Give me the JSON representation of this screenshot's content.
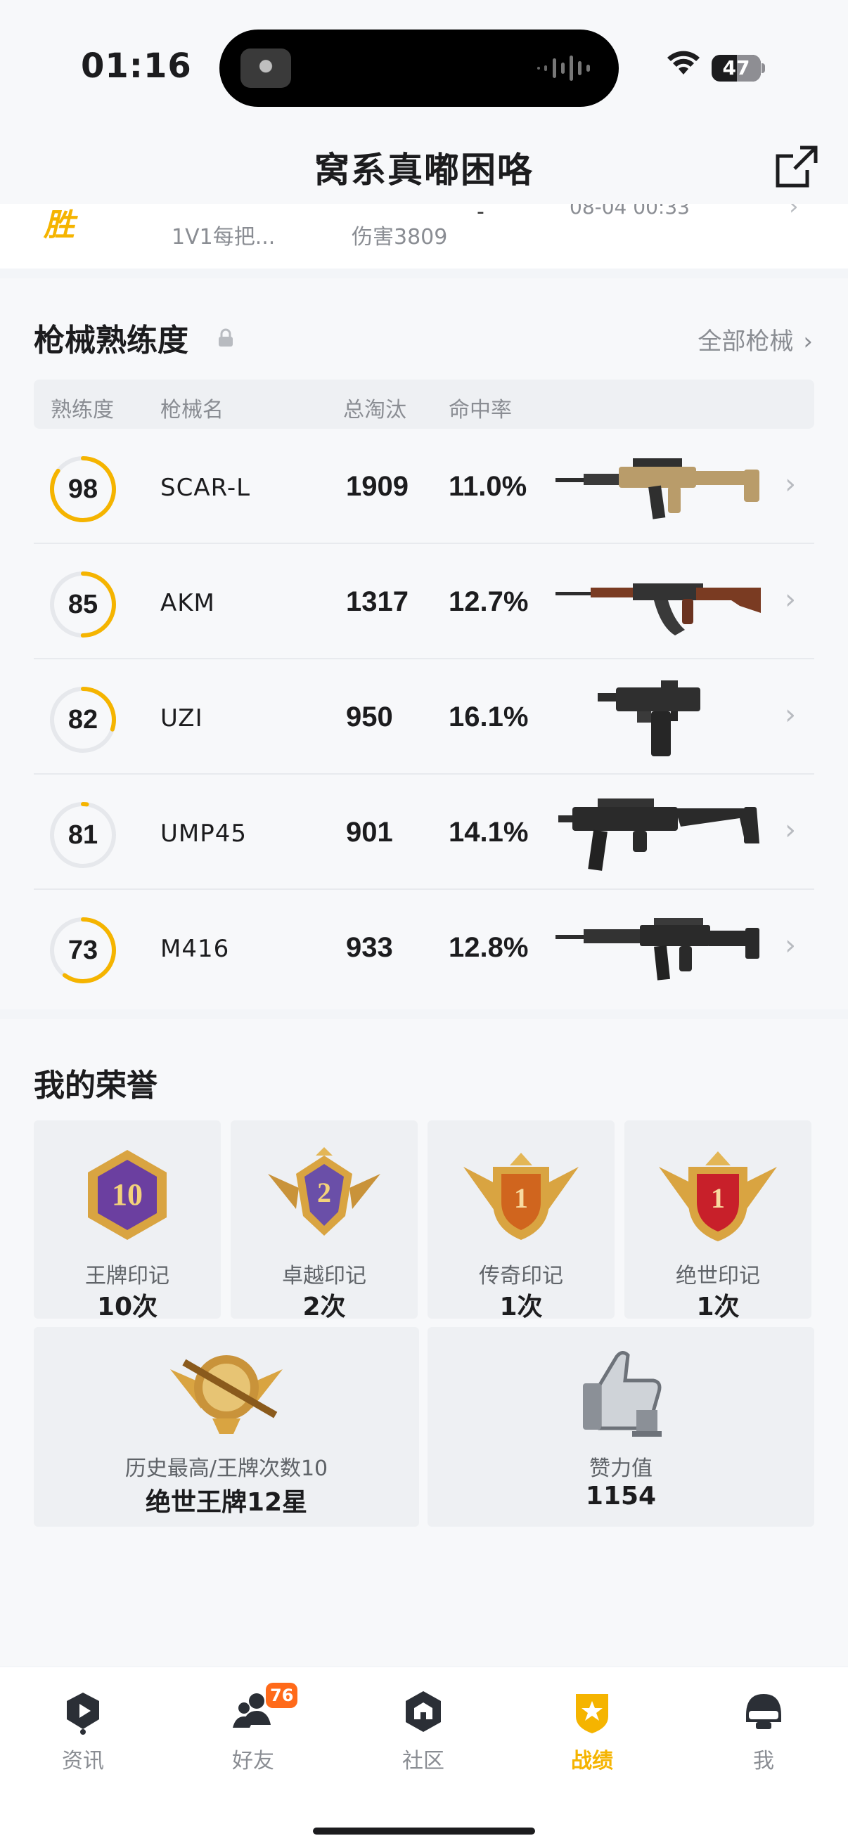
{
  "status_bar": {
    "time": "01:16",
    "battery": "47"
  },
  "header": {
    "title": "窝系真嘟困咯"
  },
  "partial_row": {
    "result_badge": "胜",
    "mode": "1V1每把...",
    "damage": "伤害3809",
    "dash": "-",
    "date": "08-04 00:33"
  },
  "weapons_section": {
    "title": "枪械熟练度",
    "all_link": "全部枪械",
    "columns": [
      "熟练度",
      "枪械名",
      "总淘汰",
      "命中率"
    ],
    "rows": [
      {
        "proficiency": "98",
        "name": "SCAR-L",
        "kills": "1909",
        "accuracy": "11.0%",
        "level": 0.85,
        "icon": "scar-l-rifle-icon"
      },
      {
        "proficiency": "85",
        "name": "AKM",
        "kills": "1317",
        "accuracy": "12.7%",
        "level": 0.5,
        "icon": "akm-rifle-icon"
      },
      {
        "proficiency": "82",
        "name": "UZI",
        "kills": "950",
        "accuracy": "16.1%",
        "level": 0.3,
        "icon": "uzi-smg-icon"
      },
      {
        "proficiency": "81",
        "name": "UMP45",
        "kills": "901",
        "accuracy": "14.1%",
        "level": 0.02,
        "icon": "ump45-smg-icon"
      },
      {
        "proficiency": "73",
        "name": "M416",
        "kills": "933",
        "accuracy": "12.8%",
        "level": 0.6,
        "icon": "m416-rifle-icon"
      }
    ]
  },
  "honors_section": {
    "title": "我的荣誉",
    "cards": [
      {
        "name": "王牌印记",
        "count": "10次",
        "medal_label": "10",
        "icon": "ace-mark-medal-icon",
        "color": "#6b3fa0"
      },
      {
        "name": "卓越印记",
        "count": "2次",
        "medal_label": "2",
        "icon": "excellence-mark-medal-icon",
        "color": "#6a4fa8"
      },
      {
        "name": "传奇印记",
        "count": "1次",
        "medal_label": "1",
        "icon": "legend-mark-medal-icon",
        "color": "#d0651e"
      },
      {
        "name": "绝世印记",
        "count": "1次",
        "medal_label": "1",
        "icon": "peerless-mark-medal-icon",
        "color": "#c8202a"
      }
    ],
    "wide_cards": [
      {
        "name": "历史最高/王牌次数10",
        "value": "绝世王牌12星",
        "icon": "highest-rank-medal-icon"
      },
      {
        "name": "赞力值",
        "value": "1154",
        "icon": "thumbs-up-icon"
      }
    ]
  },
  "tabbar": {
    "tabs": [
      {
        "label": "资讯",
        "icon": "news-icon",
        "active": false
      },
      {
        "label": "好友",
        "icon": "friends-icon",
        "active": false,
        "badge": "76"
      },
      {
        "label": "社区",
        "icon": "community-icon",
        "active": false
      },
      {
        "label": "战绩",
        "icon": "record-icon",
        "active": true
      },
      {
        "label": "我",
        "icon": "profile-helmet-icon",
        "active": false
      }
    ]
  },
  "colors": {
    "accent": "#f5b400",
    "ring_track": "#e6e8ec",
    "badge": "#ff6a1a"
  }
}
